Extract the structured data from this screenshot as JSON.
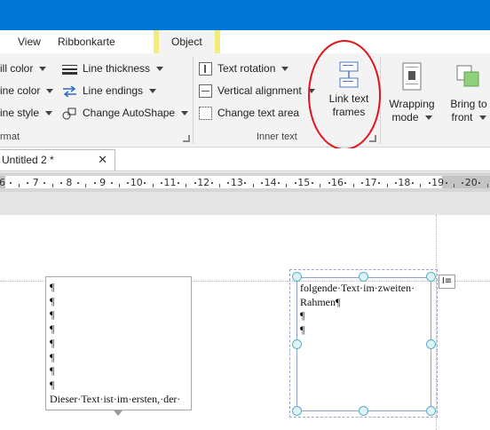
{
  "tabs": {
    "view": "View",
    "ribbonkarte": "Ribbonkarte",
    "object": "Object"
  },
  "ribbon": {
    "format_group": {
      "fill_color": "ill color",
      "line_color": "ine color",
      "line_style": "ine style",
      "line_thickness": "Line thickness",
      "line_endings": "Line endings",
      "change_autoshape": "Change AutoShape",
      "label": "rmat"
    },
    "inner_text_group": {
      "text_rotation": "Text rotation",
      "vertical_alignment": "Vertical alignment",
      "change_text_area": "Change text area",
      "link_text_frames_line1": "Link text",
      "link_text_frames_line2": "frames",
      "label": "Inner text"
    },
    "arrange_group": {
      "wrapping_mode_line1": "Wrapping",
      "wrapping_mode_line2": "mode",
      "bring_to_front_line1": "Bring to",
      "bring_to_front_line2": "front"
    }
  },
  "document_tab": {
    "title": "Untitled 2 *",
    "close": "✕"
  },
  "ruler": {
    "labels": [
      "6",
      "7",
      "8",
      "9",
      "10",
      "11",
      "12",
      "13",
      "14",
      "15",
      "16",
      "17",
      "18",
      "19",
      "20"
    ]
  },
  "frame1": {
    "text": "¶\n¶\n¶\n¶\n¶\n¶\n¶\n¶\nDieser·Text·ist·im·ersten,·der·"
  },
  "frame2": {
    "text": "folgende·Text·im·zweiten·\nRahmen¶\n¶\n¶"
  },
  "annotation": {
    "color": "#e0151b",
    "target": "link-text-frames-button"
  },
  "colors": {
    "titlebar": "#0078d7",
    "object_tab_highlight": "#f2ec7c",
    "ribbon_bg": "#f3f3f3"
  }
}
